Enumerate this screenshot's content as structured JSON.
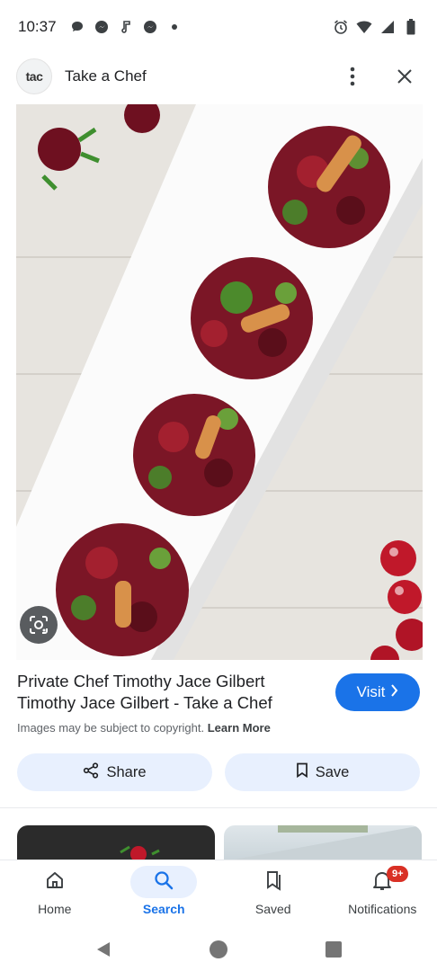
{
  "status_bar": {
    "time": "10:37",
    "left_icons": [
      "chat-bubble-icon",
      "messenger-icon",
      "music-note-icon",
      "messenger-icon",
      "dot-icon"
    ],
    "right_icons": [
      "alarm-icon",
      "wifi-icon",
      "signal-icon",
      "battery-icon"
    ]
  },
  "header": {
    "logo_text": "tac",
    "title": "Take a Chef",
    "icons": [
      "more-vert-icon",
      "close-icon"
    ]
  },
  "result": {
    "title": "Private Chef Timothy Jace Gilbert Timothy Jace Gilbert - Take a Chef",
    "copyright": "Images may be subject to copyright.",
    "learn_more": "Learn More",
    "visit_label": "Visit"
  },
  "actions": {
    "share_label": "Share",
    "save_label": "Save"
  },
  "bottom_nav": {
    "items": [
      {
        "label": "Home",
        "icon": "home-icon",
        "active": false
      },
      {
        "label": "Search",
        "icon": "search-icon",
        "active": true
      },
      {
        "label": "Saved",
        "icon": "bookmarks-icon",
        "active": false
      },
      {
        "label": "Notifications",
        "icon": "bell-icon",
        "active": false
      }
    ],
    "notification_badge": "9+"
  },
  "colors": {
    "accent": "#1a73e8",
    "pill_bg": "#e8f0fe",
    "badge": "#d93025"
  }
}
